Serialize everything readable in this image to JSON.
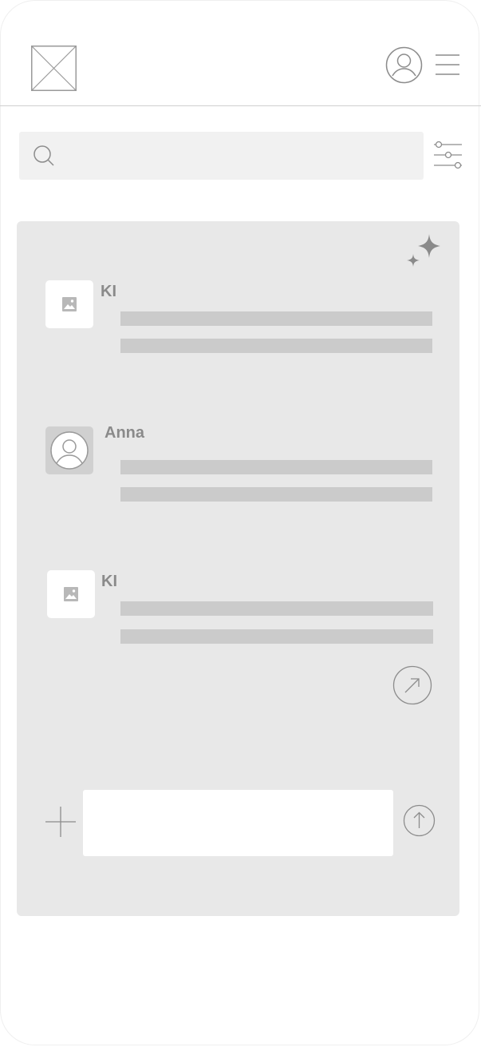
{
  "header": {
    "logo_icon": "image-placeholder-icon",
    "profile_icon": "user-circle-icon",
    "menu_icon": "hamburger-menu-icon"
  },
  "search": {
    "icon": "search-icon",
    "value": "",
    "placeholder": "",
    "filter_icon": "sliders-icon"
  },
  "chat": {
    "ai_badge_icon": "sparkle-icon",
    "messages": [
      {
        "sender": "KI",
        "avatar": "image-icon"
      },
      {
        "sender": "Anna",
        "avatar": "user-avatar"
      },
      {
        "sender": "KI",
        "avatar": "image-icon"
      }
    ],
    "open_icon": "arrow-up-right-icon",
    "composer": {
      "add_icon": "plus-icon",
      "value": "",
      "placeholder": "",
      "send_icon": "arrow-up-icon"
    }
  },
  "colors": {
    "panel": "#e8e8e8",
    "skeleton": "#cbcbcb",
    "sender_text": "#8a8a8a",
    "icon_stroke": "#8c8c8c"
  }
}
